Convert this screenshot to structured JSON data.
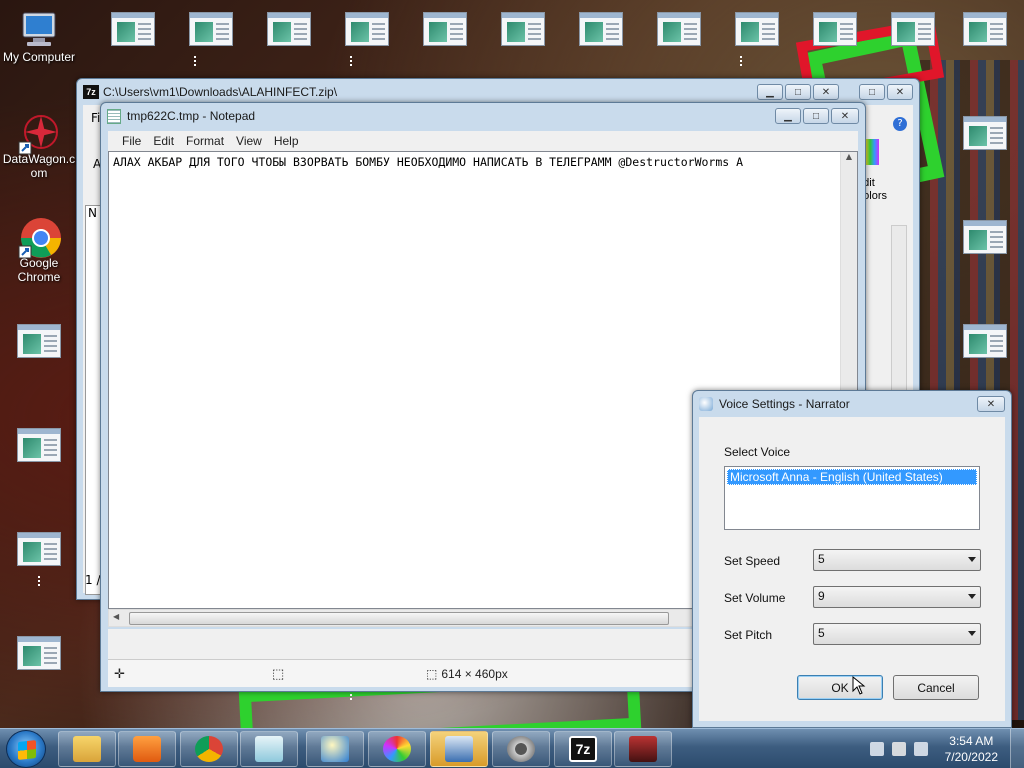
{
  "desktop": {
    "icons": [
      {
        "label": "My Computer"
      },
      {
        "label": "DataWagon.c\nom"
      },
      {
        "label": "Google\nChrome"
      }
    ]
  },
  "zip_window": {
    "title": "C:\\Users\\vm1\\Downloads\\ALAHINFECT.zip\\",
    "partial_menu": "Fi",
    "partial_toolbar": "A",
    "partial_col": "N",
    "status_left": "1 /",
    "right_fragment_1": "dit",
    "right_fragment_2": "olors"
  },
  "notepad": {
    "title": "tmp622C.tmp - Notepad",
    "menu": [
      "File",
      "Edit",
      "Format",
      "View",
      "Help"
    ],
    "content": "АЛАХ АКБАР ДЛЯ ТОГО ЧТОБЫ ВЗОРВАТЬ БОМБУ НЕОБХОДИМО НАПИСАТЬ В ТЕЛЕГРАММ @DestructorWorms А",
    "paint_status": {
      "dimensions": "614 × 460px"
    }
  },
  "voice_dialog": {
    "title": "Voice Settings - Narrator",
    "select_voice_label": "Select Voice",
    "voices": [
      "Microsoft Anna - English (United States)"
    ],
    "speed_label": "Set Speed",
    "speed_value": "5",
    "volume_label": "Set Volume",
    "volume_value": "9",
    "pitch_label": "Set Pitch",
    "pitch_value": "5",
    "ok_label": "OK",
    "cancel_label": "Cancel"
  },
  "taskbar": {
    "items": [
      "explorer",
      "media-player",
      "chrome",
      "notepad",
      "narrator",
      "paint",
      "remote",
      "settings",
      "7zip",
      "user-app"
    ],
    "zip_label": "7z",
    "clock_time": "3:54 AM",
    "clock_date": "7/20/2022"
  },
  "colors": {
    "accent": "#3399ff",
    "taskbar": "#3d5d80",
    "window_frame": "#c9dbec"
  }
}
